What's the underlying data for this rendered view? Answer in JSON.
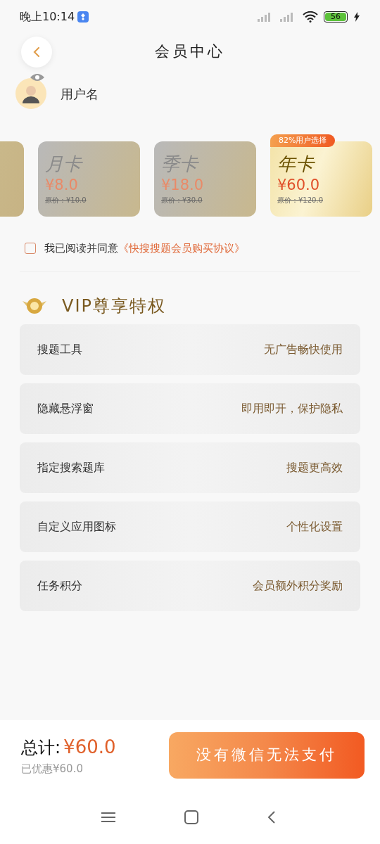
{
  "status_bar": {
    "time": "晚上10:14",
    "battery": "56"
  },
  "header": {
    "title": "会员中心"
  },
  "user": {
    "name": "用户名"
  },
  "plans": [
    {
      "name": "月卡",
      "price": "¥8.0",
      "original_price": "原价：¥10.0",
      "selected": false
    },
    {
      "name": "季卡",
      "price": "¥18.0",
      "original_price": "原价：¥30.0",
      "selected": false
    },
    {
      "name": "年卡",
      "price": "¥60.0",
      "original_price": "原价：¥120.0",
      "selected": true,
      "badge": "82%用户选择"
    }
  ],
  "agreement": {
    "checked": false,
    "text": "我已阅读并同意",
    "link": "《快搜搜题会员购买协议》"
  },
  "privileges": {
    "title": "VIP尊享特权",
    "items": [
      {
        "name": "搜题工具",
        "desc": "无广告畅快使用"
      },
      {
        "name": "隐藏悬浮窗",
        "desc": "即用即开，保护隐私"
      },
      {
        "name": "指定搜索题库",
        "desc": "搜题更高效"
      },
      {
        "name": "自定义应用图标",
        "desc": "个性化设置"
      },
      {
        "name": "任务积分",
        "desc": "会员额外积分奖励"
      }
    ]
  },
  "footer": {
    "total_label": "总计:",
    "total": "¥60.0",
    "discount": "已优惠¥60.0",
    "pay_button": "没有微信无法支付"
  }
}
